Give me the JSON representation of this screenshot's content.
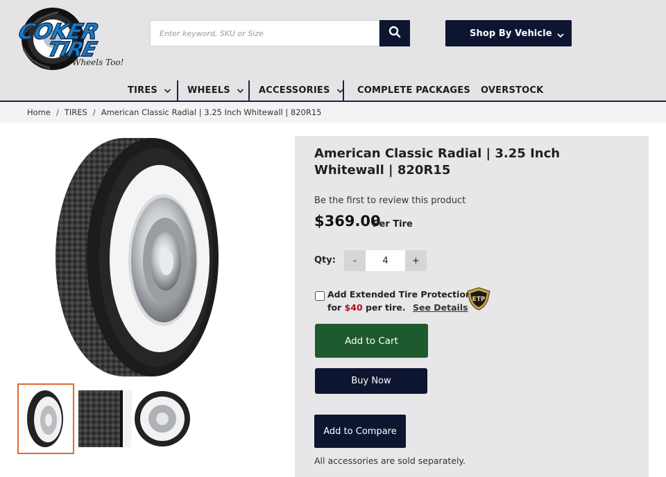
{
  "header": {
    "logo": {
      "brand": "COKER TIRE",
      "tagline": "Wheels Too!"
    },
    "search": {
      "placeholder": "Enter keyword, SKU or Size"
    },
    "shop_by_vehicle": "Shop By Vehicle"
  },
  "nav": {
    "items": [
      {
        "label": "TIRES",
        "has_dropdown": true
      },
      {
        "label": "WHEELS",
        "has_dropdown": true
      },
      {
        "label": "ACCESSORIES",
        "has_dropdown": true
      },
      {
        "label": "COMPLETE PACKAGES",
        "has_dropdown": false
      },
      {
        "label": "OVERSTOCK",
        "has_dropdown": false
      }
    ]
  },
  "breadcrumb": {
    "items": [
      "Home",
      "TIRES",
      "American Classic Radial | 3.25 Inch Whitewall | 820R15"
    ],
    "separator": "/"
  },
  "gallery": {
    "thumbnails": [
      {
        "name": "tire-front-view",
        "active": true
      },
      {
        "name": "tread-closeup",
        "active": false
      },
      {
        "name": "tire-side-view",
        "active": false
      }
    ]
  },
  "product": {
    "title": "American Classic Radial | 3.25 Inch Whitewall | 820R15",
    "review_prompt": "Be the first to review this product",
    "price": "$369.00",
    "price_unit": "Per Tire",
    "qty_label": "Qty:",
    "qty_minus": "-",
    "qty_value": "4",
    "qty_plus": "+",
    "protection": {
      "line1": "Add Extended Tire Protection",
      "for_text": "for",
      "amount": "$40",
      "per_text": "per tire.",
      "details_link": "See Details",
      "badge_text": "ETP"
    },
    "add_to_cart": "Add to Cart",
    "buy_now": "Buy Now",
    "add_to_compare": "Add to Compare",
    "accessories_note": "All accessories are sold separately."
  },
  "colors": {
    "header_bg": "#e4e4e6",
    "navy": "#0d1530",
    "cart_green": "#1f5a2e",
    "price_red": "#b0121b",
    "thumb_active_border": "#e26a2c",
    "logo_blue": "#1c7cc4"
  }
}
